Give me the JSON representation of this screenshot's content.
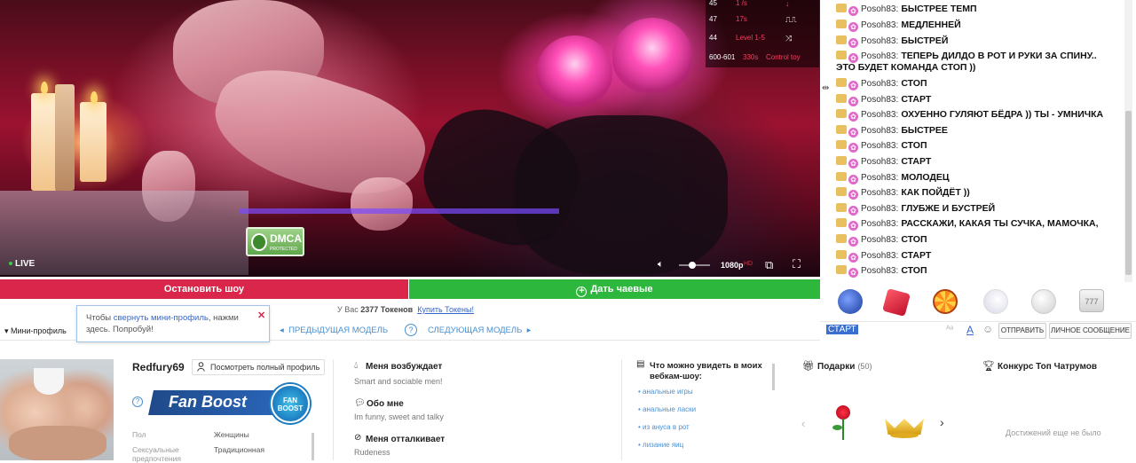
{
  "stats_overlay": {
    "rows": [
      {
        "a": "45",
        "b": "1 /s",
        "c": "down-arrow"
      },
      {
        "a": "47",
        "b": "17s",
        "c": "square-wave"
      },
      {
        "a": "44",
        "b": "Level 1-5",
        "c": "shuffle"
      },
      {
        "a": "600-601",
        "b": "330s",
        "c": "Control toy"
      }
    ]
  },
  "video": {
    "live_label": "LIVE",
    "quality": "1080p",
    "hd": "HD",
    "dmca": "DMCA",
    "dmca_sub": "PROTECTED"
  },
  "actions": {
    "stop_show": "Остановить шоу",
    "give_tip": "Дать чаевые"
  },
  "tokens": {
    "prefix": "У Вас",
    "amount": "2377",
    "suffix": "Токенов",
    "buy_link": "Купить Токены!"
  },
  "tooltip": {
    "part1": "Чтобы ",
    "highlight": "свернуть мини-профиль",
    "part2": ", нажми здесь. Попробуй!"
  },
  "mini_bar": {
    "label": "Мини-профиль",
    "prev": "ПРЕДЫДУЩАЯ МОДЕЛЬ",
    "next": "СЛЕДУЮЩАЯ МОДЕЛЬ",
    "help": "?"
  },
  "profile": {
    "name": "Redfury69",
    "full_profile": "Посмотреть полный профиль",
    "fan_boost": "Fan Boost",
    "fan_badge_1": "FAN",
    "fan_badge_2": "BOOST",
    "fields": [
      {
        "label": "Пол",
        "value": "Женщины"
      },
      {
        "label": "Сексуальные предпочтения",
        "value": "Традиционная"
      }
    ]
  },
  "about": {
    "turns_on_title": "Меня возбуждает",
    "turns_on_text": "Smart and sociable men!",
    "about_me_title": "Обо мне",
    "about_me_text": "Im funny, sweet and talky",
    "turns_off_title": "Меня отталкивает",
    "turns_off_text": "Rudeness"
  },
  "show_list": {
    "title": "Что можно увидеть в моих вебкам-шоу:",
    "items": [
      "анальные игры",
      "анальные ласки",
      "из ануса в рот",
      "лизание яиц"
    ]
  },
  "gifts": {
    "title": "Подарки",
    "count": "(50)"
  },
  "contest": {
    "title": "Конкурс Топ Чатрумов",
    "no_achievements": "Достижений еще не было"
  },
  "chat": {
    "messages": [
      {
        "user": "Posoh83:",
        "text": "БЫСТРЕЕ ТЕМП"
      },
      {
        "user": "Posoh83:",
        "text": "МЕДЛЕННЕЙ"
      },
      {
        "user": "Posoh83:",
        "text": "БЫСТРЕЙ"
      },
      {
        "user": "Posoh83:",
        "text": "ТЕПЕРЬ ДИЛДО В РОТ И РУКИ ЗА СПИНУ.."
      },
      {
        "user": "",
        "text": "ЭТО БУДЕТ КОМАНДА СТОП ))"
      },
      {
        "user": "Posoh83:",
        "text": "СТОП"
      },
      {
        "user": "Posoh83:",
        "text": "СТАРТ"
      },
      {
        "user": "Posoh83:",
        "text": "ОХУЕННО ГУЛЯЮТ БЁДРА )) ТЫ - УМНИЧКА"
      },
      {
        "user": "Posoh83:",
        "text": "БЫСТРЕЕ"
      },
      {
        "user": "Posoh83:",
        "text": "СТОП"
      },
      {
        "user": "Posoh83:",
        "text": "СТАРТ"
      },
      {
        "user": "Posoh83:",
        "text": "МОЛОДЕЦ"
      },
      {
        "user": "Posoh83:",
        "text": "КАК ПОЙДЁТ ))"
      },
      {
        "user": "Posoh83:",
        "text": "ГЛУБЖЕ И БУСТРЕЙ"
      },
      {
        "user": "Posoh83:",
        "text": "РАССКАЖИ, КАКАЯ ТЫ СУЧКА, МАМОЧКА,"
      },
      {
        "user": "Posoh83:",
        "text": "СТОП"
      },
      {
        "user": "Posoh83:",
        "text": "СТАРТ"
      },
      {
        "user": "Posoh83:",
        "text": "СТОП"
      }
    ],
    "input_value": "СТАРТ",
    "send": "ОТПРАВИТЬ",
    "private_message": "ЛИЧНОЕ СООБЩЕНИЕ",
    "tip_icons": [
      "music-disc-icon",
      "dice-icon",
      "wheel-of-fortune-icon",
      "moon-icon",
      "bingo-ball-icon",
      "slot-777-icon"
    ]
  },
  "colors": {
    "stop_red": "#d9264a",
    "tip_green": "#2db83d",
    "link_blue": "#4a90d0"
  }
}
